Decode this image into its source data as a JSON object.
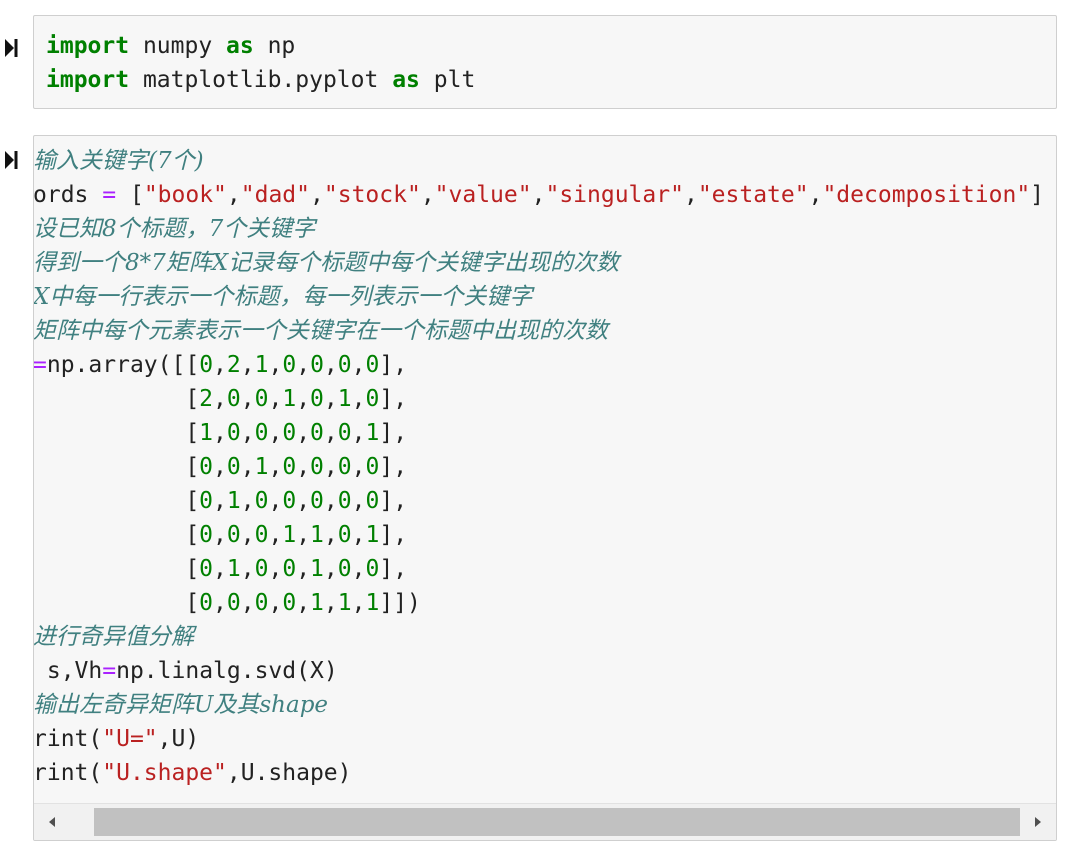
{
  "colors": {
    "keyword": "#008000",
    "string": "#ba2121",
    "number": "#008000",
    "operator": "#aa22ff",
    "comment": "#408080"
  },
  "icons": {
    "run": "run-step-icon",
    "scroll_left": "triangle-left-icon",
    "scroll_right": "triangle-right-icon"
  },
  "cell1": {
    "lines": [
      [
        {
          "t": "kw",
          "v": "import"
        },
        {
          "t": "plain",
          "v": " numpy "
        },
        {
          "t": "kw",
          "v": "as"
        },
        {
          "t": "plain",
          "v": " np"
        }
      ],
      [
        {
          "t": "kw",
          "v": "import"
        },
        {
          "t": "plain",
          "v": " matplotlib.pyplot "
        },
        {
          "t": "kw",
          "v": "as"
        },
        {
          "t": "plain",
          "v": " plt"
        }
      ]
    ]
  },
  "cell2": {
    "lines": [
      [
        {
          "t": "cm",
          "v": "输入关键字(7个)"
        }
      ],
      [
        {
          "t": "plain",
          "v": "ords "
        },
        {
          "t": "op",
          "v": "="
        },
        {
          "t": "plain",
          "v": " ["
        },
        {
          "t": "str",
          "v": "\"book\""
        },
        {
          "t": "plain",
          "v": ","
        },
        {
          "t": "str",
          "v": "\"dad\""
        },
        {
          "t": "plain",
          "v": ","
        },
        {
          "t": "str",
          "v": "\"stock\""
        },
        {
          "t": "plain",
          "v": ","
        },
        {
          "t": "str",
          "v": "\"value\""
        },
        {
          "t": "plain",
          "v": ","
        },
        {
          "t": "str",
          "v": "\"singular\""
        },
        {
          "t": "plain",
          "v": ","
        },
        {
          "t": "str",
          "v": "\"estate\""
        },
        {
          "t": "plain",
          "v": ","
        },
        {
          "t": "str",
          "v": "\"decomposition\""
        },
        {
          "t": "plain",
          "v": "]"
        }
      ],
      [
        {
          "t": "cm",
          "v": "设已知8个标题，7个关键字"
        }
      ],
      [
        {
          "t": "cm",
          "v": "得到一个8*7矩阵X记录每个标题中每个关键字出现的次数"
        }
      ],
      [
        {
          "t": "cm",
          "v": "X中每一行表示一个标题，每一列表示一个关键字"
        }
      ],
      [
        {
          "t": "cm",
          "v": "矩阵中每个元素表示一个关键字在一个标题中出现的次数"
        }
      ],
      [
        {
          "t": "op",
          "v": "="
        },
        {
          "t": "plain",
          "v": "np.array([["
        },
        {
          "t": "num",
          "v": "0"
        },
        {
          "t": "plain",
          "v": ","
        },
        {
          "t": "num",
          "v": "2"
        },
        {
          "t": "plain",
          "v": ","
        },
        {
          "t": "num",
          "v": "1"
        },
        {
          "t": "plain",
          "v": ","
        },
        {
          "t": "num",
          "v": "0"
        },
        {
          "t": "plain",
          "v": ","
        },
        {
          "t": "num",
          "v": "0"
        },
        {
          "t": "plain",
          "v": ","
        },
        {
          "t": "num",
          "v": "0"
        },
        {
          "t": "plain",
          "v": ","
        },
        {
          "t": "num",
          "v": "0"
        },
        {
          "t": "plain",
          "v": "],"
        }
      ],
      [
        {
          "t": "plain",
          "v": "           ["
        },
        {
          "t": "num",
          "v": "2"
        },
        {
          "t": "plain",
          "v": ","
        },
        {
          "t": "num",
          "v": "0"
        },
        {
          "t": "plain",
          "v": ","
        },
        {
          "t": "num",
          "v": "0"
        },
        {
          "t": "plain",
          "v": ","
        },
        {
          "t": "num",
          "v": "1"
        },
        {
          "t": "plain",
          "v": ","
        },
        {
          "t": "num",
          "v": "0"
        },
        {
          "t": "plain",
          "v": ","
        },
        {
          "t": "num",
          "v": "1"
        },
        {
          "t": "plain",
          "v": ","
        },
        {
          "t": "num",
          "v": "0"
        },
        {
          "t": "plain",
          "v": "],"
        }
      ],
      [
        {
          "t": "plain",
          "v": "           ["
        },
        {
          "t": "num",
          "v": "1"
        },
        {
          "t": "plain",
          "v": ","
        },
        {
          "t": "num",
          "v": "0"
        },
        {
          "t": "plain",
          "v": ","
        },
        {
          "t": "num",
          "v": "0"
        },
        {
          "t": "plain",
          "v": ","
        },
        {
          "t": "num",
          "v": "0"
        },
        {
          "t": "plain",
          "v": ","
        },
        {
          "t": "num",
          "v": "0"
        },
        {
          "t": "plain",
          "v": ","
        },
        {
          "t": "num",
          "v": "0"
        },
        {
          "t": "plain",
          "v": ","
        },
        {
          "t": "num",
          "v": "1"
        },
        {
          "t": "plain",
          "v": "],"
        }
      ],
      [
        {
          "t": "plain",
          "v": "           ["
        },
        {
          "t": "num",
          "v": "0"
        },
        {
          "t": "plain",
          "v": ","
        },
        {
          "t": "num",
          "v": "0"
        },
        {
          "t": "plain",
          "v": ","
        },
        {
          "t": "num",
          "v": "1"
        },
        {
          "t": "plain",
          "v": ","
        },
        {
          "t": "num",
          "v": "0"
        },
        {
          "t": "plain",
          "v": ","
        },
        {
          "t": "num",
          "v": "0"
        },
        {
          "t": "plain",
          "v": ","
        },
        {
          "t": "num",
          "v": "0"
        },
        {
          "t": "plain",
          "v": ","
        },
        {
          "t": "num",
          "v": "0"
        },
        {
          "t": "plain",
          "v": "],"
        }
      ],
      [
        {
          "t": "plain",
          "v": "           ["
        },
        {
          "t": "num",
          "v": "0"
        },
        {
          "t": "plain",
          "v": ","
        },
        {
          "t": "num",
          "v": "1"
        },
        {
          "t": "plain",
          "v": ","
        },
        {
          "t": "num",
          "v": "0"
        },
        {
          "t": "plain",
          "v": ","
        },
        {
          "t": "num",
          "v": "0"
        },
        {
          "t": "plain",
          "v": ","
        },
        {
          "t": "num",
          "v": "0"
        },
        {
          "t": "plain",
          "v": ","
        },
        {
          "t": "num",
          "v": "0"
        },
        {
          "t": "plain",
          "v": ","
        },
        {
          "t": "num",
          "v": "0"
        },
        {
          "t": "plain",
          "v": "],"
        }
      ],
      [
        {
          "t": "plain",
          "v": "           ["
        },
        {
          "t": "num",
          "v": "0"
        },
        {
          "t": "plain",
          "v": ","
        },
        {
          "t": "num",
          "v": "0"
        },
        {
          "t": "plain",
          "v": ","
        },
        {
          "t": "num",
          "v": "0"
        },
        {
          "t": "plain",
          "v": ","
        },
        {
          "t": "num",
          "v": "1"
        },
        {
          "t": "plain",
          "v": ","
        },
        {
          "t": "num",
          "v": "1"
        },
        {
          "t": "plain",
          "v": ","
        },
        {
          "t": "num",
          "v": "0"
        },
        {
          "t": "plain",
          "v": ","
        },
        {
          "t": "num",
          "v": "1"
        },
        {
          "t": "plain",
          "v": "],"
        }
      ],
      [
        {
          "t": "plain",
          "v": "           ["
        },
        {
          "t": "num",
          "v": "0"
        },
        {
          "t": "plain",
          "v": ","
        },
        {
          "t": "num",
          "v": "1"
        },
        {
          "t": "plain",
          "v": ","
        },
        {
          "t": "num",
          "v": "0"
        },
        {
          "t": "plain",
          "v": ","
        },
        {
          "t": "num",
          "v": "0"
        },
        {
          "t": "plain",
          "v": ","
        },
        {
          "t": "num",
          "v": "1"
        },
        {
          "t": "plain",
          "v": ","
        },
        {
          "t": "num",
          "v": "0"
        },
        {
          "t": "plain",
          "v": ","
        },
        {
          "t": "num",
          "v": "0"
        },
        {
          "t": "plain",
          "v": "],"
        }
      ],
      [
        {
          "t": "plain",
          "v": "           ["
        },
        {
          "t": "num",
          "v": "0"
        },
        {
          "t": "plain",
          "v": ","
        },
        {
          "t": "num",
          "v": "0"
        },
        {
          "t": "plain",
          "v": ","
        },
        {
          "t": "num",
          "v": "0"
        },
        {
          "t": "plain",
          "v": ","
        },
        {
          "t": "num",
          "v": "0"
        },
        {
          "t": "plain",
          "v": ","
        },
        {
          "t": "num",
          "v": "1"
        },
        {
          "t": "plain",
          "v": ","
        },
        {
          "t": "num",
          "v": "1"
        },
        {
          "t": "plain",
          "v": ","
        },
        {
          "t": "num",
          "v": "1"
        },
        {
          "t": "plain",
          "v": "]])"
        }
      ],
      [
        {
          "t": "cm",
          "v": "进行奇异值分解"
        }
      ],
      [
        {
          "t": "plain",
          "v": " s,Vh"
        },
        {
          "t": "op",
          "v": "="
        },
        {
          "t": "plain",
          "v": "np.linalg.svd(X)"
        }
      ],
      [
        {
          "t": "cm",
          "v": "输出左奇异矩阵U及其shape"
        }
      ],
      [
        {
          "t": "plain",
          "v": "rint("
        },
        {
          "t": "str",
          "v": "\"U=\""
        },
        {
          "t": "plain",
          "v": ",U)"
        }
      ],
      [
        {
          "t": "plain",
          "v": "rint("
        },
        {
          "t": "str",
          "v": "\"U.shape\""
        },
        {
          "t": "plain",
          "v": ",U.shape)"
        }
      ]
    ]
  }
}
